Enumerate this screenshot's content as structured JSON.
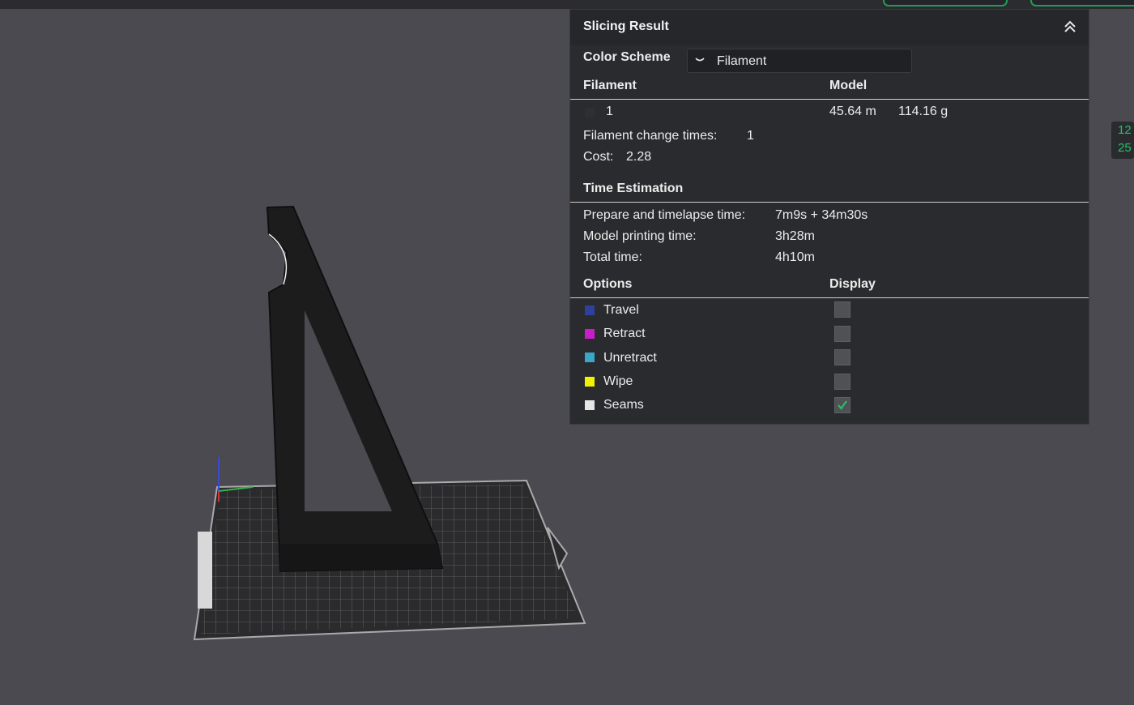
{
  "panel": {
    "title": "Slicing Result",
    "color_scheme": {
      "label": "Color Scheme",
      "value": "Filament"
    },
    "filament_table": {
      "headers": {
        "left": "Filament",
        "right": "Model"
      },
      "rows": [
        {
          "id": "1",
          "length": "45.64 m",
          "weight": "114.16 g",
          "color": "#2f2f2f"
        }
      ]
    },
    "filament_change": {
      "label": "Filament change times:",
      "value": "1"
    },
    "cost": {
      "label": "Cost:",
      "value": "2.28"
    },
    "time_estimation": {
      "title": "Time Estimation",
      "rows": [
        {
          "label": "Prepare and timelapse time:",
          "value": "7m9s + 34m30s"
        },
        {
          "label": "Model printing time:",
          "value": "3h28m"
        },
        {
          "label": "Total time:",
          "value": "4h10m"
        }
      ]
    },
    "options": {
      "headers": {
        "left": "Options",
        "right": "Display"
      },
      "items": [
        {
          "label": "Travel",
          "color": "#2f3f9e",
          "checked": false
        },
        {
          "label": "Retract",
          "color": "#c71ec7",
          "checked": false
        },
        {
          "label": "Unretract",
          "color": "#3aa7c9",
          "checked": false
        },
        {
          "label": "Wipe",
          "color": "#f2f200",
          "checked": false
        },
        {
          "label": "Seams",
          "color": "#e6e6e6",
          "checked": true
        }
      ]
    }
  },
  "side_label": {
    "line1": "12",
    "line2": "25"
  },
  "colors": {
    "accent": "#27c06a",
    "background": "#4a4a50",
    "panel": "#2a2b2f"
  }
}
